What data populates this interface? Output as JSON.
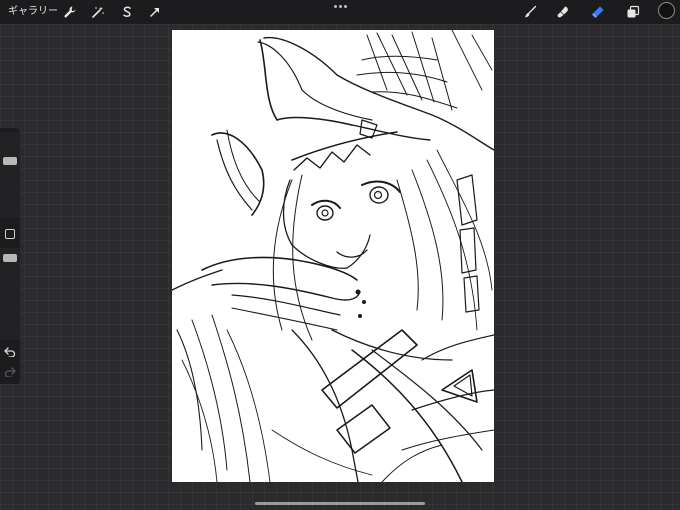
{
  "toolbar": {
    "gallery_label": "ギャラリー",
    "left_tools": [
      {
        "name": "actions-icon"
      },
      {
        "name": "adjustments-icon"
      },
      {
        "name": "selection-icon"
      },
      {
        "name": "transform-icon"
      }
    ],
    "right_tools": [
      {
        "name": "brush-icon"
      },
      {
        "name": "smudge-icon"
      },
      {
        "name": "eraser-icon",
        "active": true
      },
      {
        "name": "layers-icon"
      }
    ],
    "active_color": "#111111",
    "accent_color": "#3a7bf0"
  }
}
